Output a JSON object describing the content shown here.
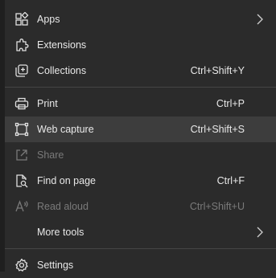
{
  "menu": {
    "items": [
      {
        "label": "Apps",
        "shortcut": "",
        "icon": "apps-icon",
        "submenu": true
      },
      {
        "label": "Extensions",
        "shortcut": "",
        "icon": "extensions-icon"
      },
      {
        "label": "Collections",
        "shortcut": "Ctrl+Shift+Y",
        "icon": "collections-icon"
      },
      {
        "label": "Print",
        "shortcut": "Ctrl+P",
        "icon": "print-icon"
      },
      {
        "label": "Web capture",
        "shortcut": "Ctrl+Shift+S",
        "icon": "web-capture-icon",
        "highlighted": true
      },
      {
        "label": "Share",
        "shortcut": "",
        "icon": "share-icon",
        "disabled": true
      },
      {
        "label": "Find on page",
        "shortcut": "Ctrl+F",
        "icon": "find-icon"
      },
      {
        "label": "Read aloud",
        "shortcut": "Ctrl+Shift+U",
        "icon": "read-aloud-icon",
        "disabled": true
      },
      {
        "label": "More tools",
        "shortcut": "",
        "icon": "",
        "submenu": true
      },
      {
        "label": "Settings",
        "shortcut": "",
        "icon": "settings-icon"
      }
    ]
  },
  "colors": {
    "background": "#2b2b2b",
    "highlight": "#3d3d3d",
    "text": "#e8e8e8",
    "disabled_text": "#7a7a7a",
    "separator": "#454545"
  }
}
